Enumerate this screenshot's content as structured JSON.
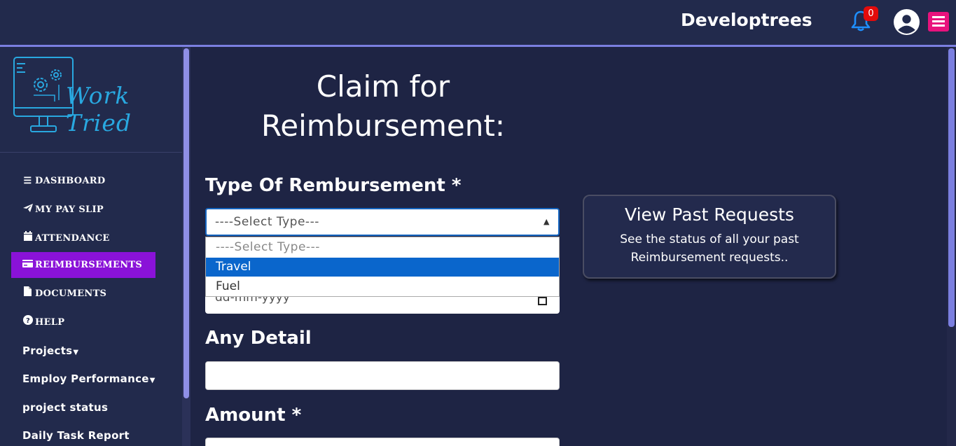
{
  "header": {
    "brand": "Developtrees",
    "notification_count": "0",
    "icons": [
      "bell-icon",
      "user-avatar-icon",
      "hamburger-menu-icon"
    ],
    "accent_color": "#e8127d"
  },
  "sidebar": {
    "logo_text": "Work Tried",
    "items": [
      {
        "label": "DASHBOARD",
        "icon": "bars-icon"
      },
      {
        "label": "MY PAY SLIP",
        "icon": "paper-plane-icon"
      },
      {
        "label": "ATTENDANCE",
        "icon": "calendar-icon"
      },
      {
        "label": "REIMBURSEMENTS",
        "icon": "credit-card-icon",
        "active": true
      },
      {
        "label": "DOCUMENTS",
        "icon": "file-icon"
      },
      {
        "label": "HELP",
        "icon": "question-circle-icon"
      },
      {
        "label": "Projects",
        "dropdown": true
      },
      {
        "label": "Employ Performance",
        "dropdown": true
      },
      {
        "label": "project status"
      },
      {
        "label": "Daily Task Report"
      }
    ],
    "active_color": "#8a12d8"
  },
  "main": {
    "title": "Claim for Reimbursement:",
    "type_label": "Type Of Rembursement *",
    "type_select": {
      "value": "----Select Type---",
      "options": [
        "----Select Type---",
        "Travel",
        "Fuel"
      ],
      "highlighted": "Travel"
    },
    "date_placeholder": "dd-mm-yyyy",
    "detail_label": "Any Detail",
    "amount_label": "Amount *"
  },
  "past_requests": {
    "title": "View Past Requests",
    "description": "See the status of all your past Reimbursement requests.."
  }
}
